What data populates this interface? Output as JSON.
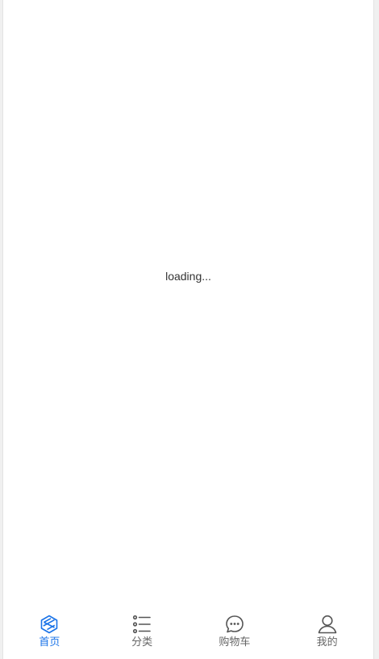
{
  "status": {
    "loading_text": "loading..."
  },
  "tabbar": {
    "active_color": "#1a73e8",
    "inactive_color": "#666666",
    "tabs": [
      {
        "label": "首页",
        "icon": "home-icon",
        "active": true
      },
      {
        "label": "分类",
        "icon": "category-list-icon",
        "active": false
      },
      {
        "label": "购物车",
        "icon": "chat-bubble-icon",
        "active": false
      },
      {
        "label": "我的",
        "icon": "user-icon",
        "active": false
      }
    ]
  }
}
